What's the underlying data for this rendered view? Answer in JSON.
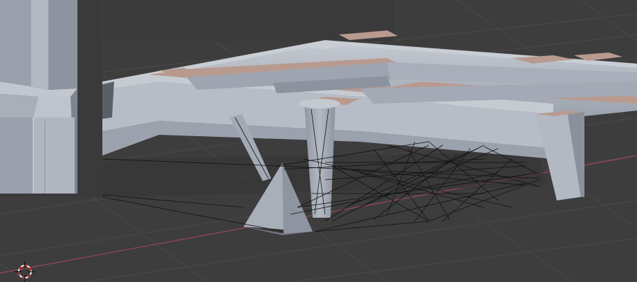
{
  "viewport": {
    "view": "3D Viewport",
    "shading": "solid",
    "background_color": "#3d3d3d",
    "grid_color": "#4a4a4a",
    "x_axis_color": "#9a4a55",
    "object_color": "#aab0bb",
    "top_face_color": "#b89a8f",
    "wire_color": "#111111"
  },
  "cursor": {
    "icon": "3d-cursor-icon"
  }
}
